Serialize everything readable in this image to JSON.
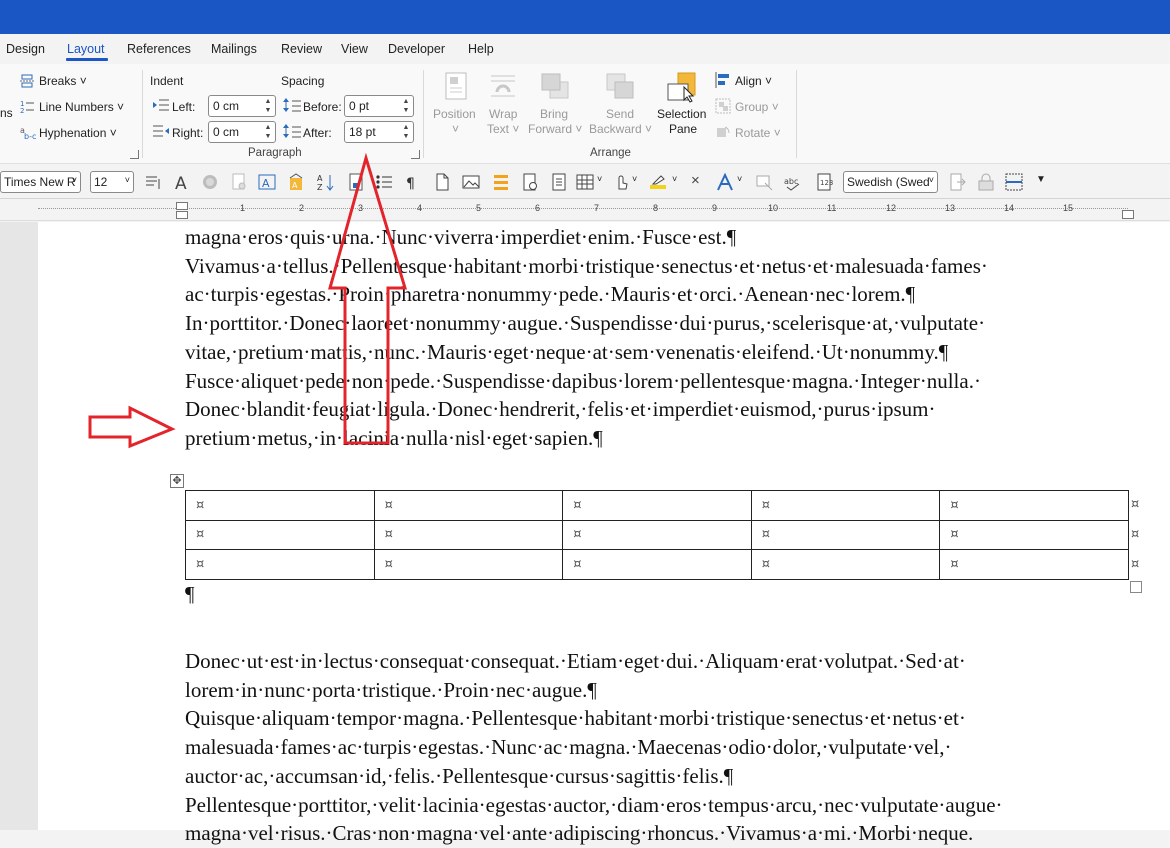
{
  "ribbon_tabs": [
    "Design",
    "Layout",
    "References",
    "Mailings",
    "Review",
    "View",
    "Developer",
    "Help"
  ],
  "page_setup": {
    "cut_label": "ns",
    "breaks": "Breaks",
    "line_numbers": "Line Numbers",
    "hyphenation": "Hyphenation"
  },
  "paragraph": {
    "indent_heading": "Indent",
    "spacing_heading": "Spacing",
    "left_label": "Left:",
    "right_label": "Right:",
    "before_label": "Before:",
    "after_label": "After:",
    "left_value": "0 cm",
    "right_value": "0 cm",
    "before_value": "0 pt",
    "after_value": "18 pt",
    "group_label": "Paragraph"
  },
  "arrange": {
    "position": "Position",
    "wrap_text_1": "Wrap",
    "wrap_text_2": "Text",
    "bring_forward_1": "Bring",
    "bring_forward_2": "Forward",
    "send_backward_1": "Send",
    "send_backward_2": "Backward",
    "selection_pane_1": "Selection",
    "selection_pane_2": "Pane",
    "align": "Align",
    "group": "Group",
    "rotate": "Rotate",
    "group_label": "Arrange"
  },
  "quick_toolbar": {
    "font_name": "Times New R",
    "font_size": "12",
    "language": "Swedish (Swed"
  },
  "ruler_numbers": [
    "1",
    "2",
    "3",
    "4",
    "5",
    "6",
    "7",
    "8",
    "9",
    "10",
    "11",
    "12",
    "13",
    "14",
    "15"
  ],
  "document": {
    "lines_top": [
      "magna·eros·quis·urna.·Nunc·viverra·imperdiet·enim.·Fusce·est.¶",
      "Vivamus·a·tellus.·Pellentesque·habitant·morbi·tristique·senectus·et·netus·et·malesuada·fames·",
      "ac·turpis·egestas.·Proin·pharetra·nonummy·pede.·Mauris·et·orci.·Aenean·nec·lorem.¶",
      "In·porttitor.·Donec·laoreet·nonummy·augue.·Suspendisse·dui·purus,·scelerisque·at,·vulputate·",
      "vitae,·pretium·mattis,·nunc.·Mauris·eget·neque·at·sem·venenatis·eleifend.·Ut·nonummy.¶",
      "Fusce·aliquet·pede·non·pede.·Suspendisse·dapibus·lorem·pellentesque·magna.·Integer·nulla.·",
      "Donec·blandit·feugiat·ligula.·Donec·hendrerit,·felis·et·imperdiet·euismod,·purus·ipsum·",
      "pretium·metus,·in·lacinia·nulla·nisl·eget·sapien.¶"
    ],
    "cell_mark": "¤",
    "pilcrow": "¶",
    "lines_bottom": [
      "Donec·ut·est·in·lectus·consequat·consequat.·Etiam·eget·dui.·Aliquam·erat·volutpat.·Sed·at·",
      "lorem·in·nunc·porta·tristique.·Proin·nec·augue.¶",
      "Quisque·aliquam·tempor·magna.·Pellentesque·habitant·morbi·tristique·senectus·et·netus·et·",
      "malesuada·fames·ac·turpis·egestas.·Nunc·ac·magna.·Maecenas·odio·dolor,·vulputate·vel,·",
      "auctor·ac,·accumsan·id,·felis.·Pellentesque·cursus·sagittis·felis.¶",
      "Pellentesque·porttitor,·velit·lacinia·egestas·auctor,·diam·eros·tempus·arcu,·nec·vulputate·augue·",
      "magna·vel·risus.·Cras·non·magna·vel·ante·adipiscing·rhoncus.·Vivamus·a·mi.·Morbi·neque."
    ]
  }
}
